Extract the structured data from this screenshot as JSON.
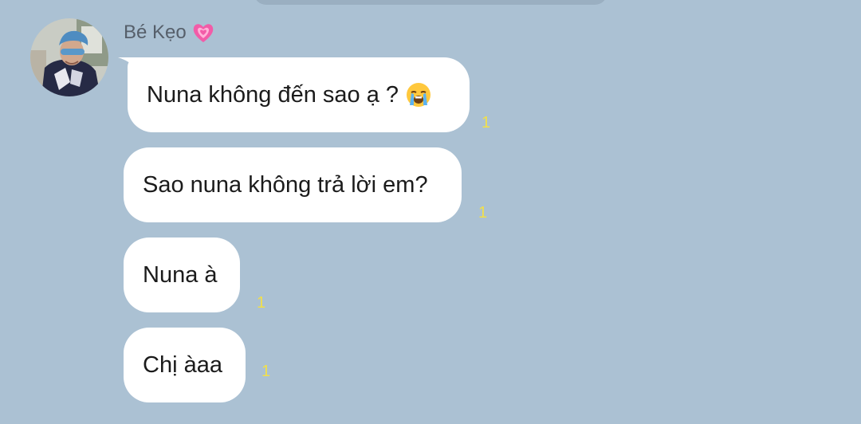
{
  "chat": {
    "sender_name": "Bé Kẹo",
    "sender_emoji": "growing-heart-icon",
    "messages": [
      {
        "text": "Nuna không đến sao ạ ?",
        "emoji": "loudly-crying-face-icon",
        "unread": "1"
      },
      {
        "text": "Sao nuna không trả lời em?",
        "unread": "1"
      },
      {
        "text": "Nuna à",
        "unread": "1"
      },
      {
        "text": "Chị àaa",
        "unread": "1"
      }
    ]
  },
  "colors": {
    "background": "#abc1d3",
    "bubble": "#ffffff",
    "unread_count": "#f2e049",
    "sender_name": "#565f6a"
  }
}
